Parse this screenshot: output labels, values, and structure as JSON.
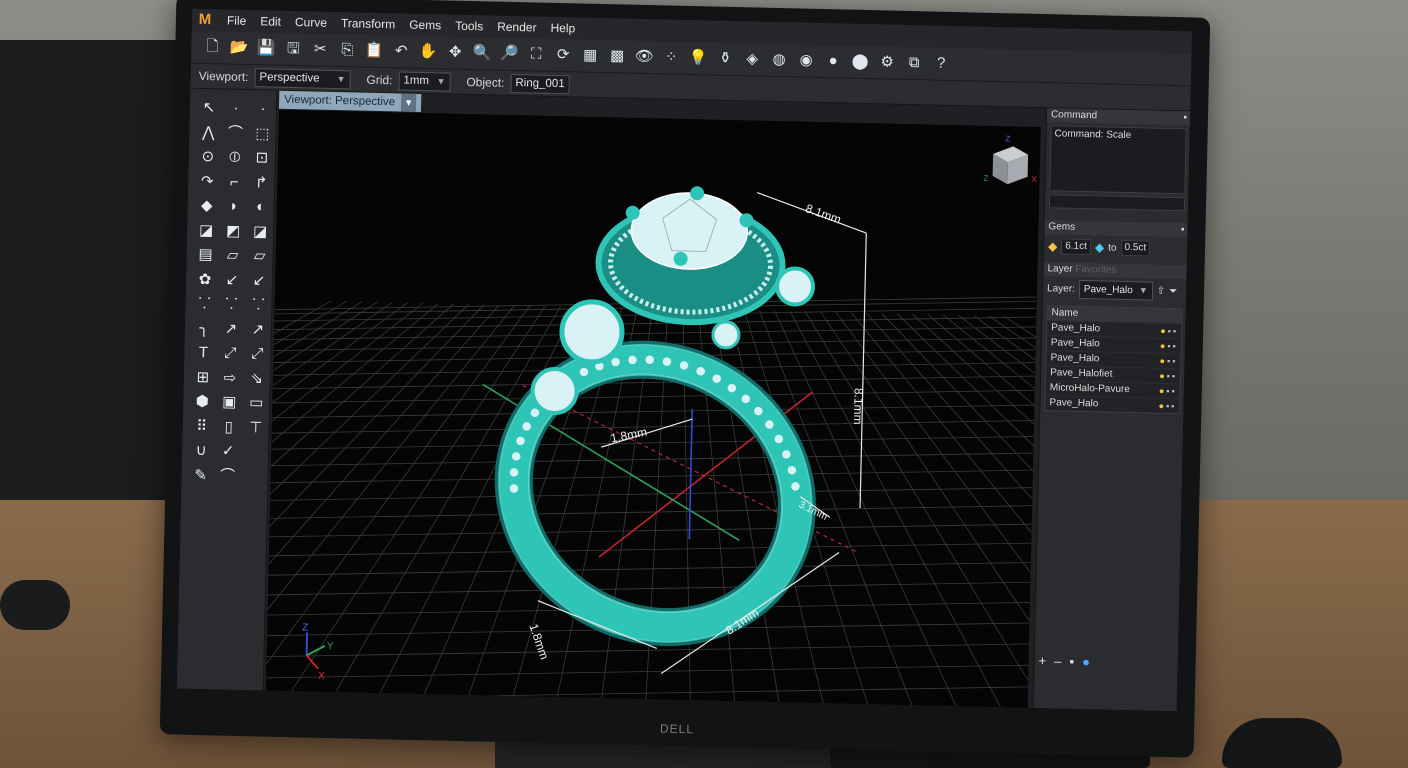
{
  "app": {
    "logo": "M",
    "menu": [
      "File",
      "Edit",
      "Curve",
      "Transform",
      "Gems",
      "Tools",
      "Render",
      "Help"
    ],
    "window_controls": [
      "–",
      "□",
      "✕"
    ]
  },
  "toolbar": {
    "icons": [
      {
        "name": "new-file-icon",
        "glyph": "🗋"
      },
      {
        "name": "open-folder-icon",
        "glyph": "📂"
      },
      {
        "name": "save-icon",
        "glyph": "💾"
      },
      {
        "name": "save-all-icon",
        "glyph": "🖫"
      },
      {
        "name": "cut-icon",
        "glyph": "✂"
      },
      {
        "name": "copy-icon",
        "glyph": "⎘"
      },
      {
        "name": "paste-icon",
        "glyph": "📋"
      },
      {
        "name": "undo-icon",
        "glyph": "↶"
      },
      {
        "name": "pan-hand-icon",
        "glyph": "✋"
      },
      {
        "name": "move-icon",
        "glyph": "✥"
      },
      {
        "name": "zoom-in-icon",
        "glyph": "🔍"
      },
      {
        "name": "zoom-window-icon",
        "glyph": "🔎"
      },
      {
        "name": "zoom-extents-icon",
        "glyph": "⛶"
      },
      {
        "name": "rotate-view-icon",
        "glyph": "⟳"
      },
      {
        "name": "grid-icon",
        "glyph": "▦"
      },
      {
        "name": "viewports-icon",
        "glyph": "▩"
      },
      {
        "name": "eye-icon",
        "glyph": "👁"
      },
      {
        "name": "dots-icon",
        "glyph": "⁘"
      },
      {
        "name": "light-bulb-icon",
        "glyph": "💡"
      },
      {
        "name": "bottle-icon",
        "glyph": "⚱"
      },
      {
        "name": "layers-icon",
        "glyph": "◈"
      },
      {
        "name": "material-icon",
        "glyph": "◍"
      },
      {
        "name": "sphere-icon",
        "glyph": "◉"
      },
      {
        "name": "shade-icon",
        "glyph": "●"
      },
      {
        "name": "render-ball-icon",
        "glyph": "⬤"
      },
      {
        "name": "scripts-icon",
        "glyph": "⚙"
      },
      {
        "name": "plugin-icon",
        "glyph": "⧉"
      },
      {
        "name": "help-icon",
        "glyph": "?"
      }
    ]
  },
  "options": {
    "viewport_label": "Viewport:",
    "viewport_value": "Perspective",
    "grid_label": "Grid:",
    "grid_value": "1mm",
    "object_label": "Object:",
    "object_value": "Ring_001"
  },
  "palette": {
    "icons": [
      "↖",
      "·",
      "·",
      "⋀",
      "⌒",
      "⬚",
      "⊙",
      "⦶",
      "⊡",
      "↷",
      "⌐",
      "↱",
      "◆",
      "◗",
      "◐",
      "◪",
      "◩",
      "◪",
      "▤",
      "▱",
      "▱",
      "✿",
      "↙",
      "↙",
      "⸪",
      "⸪",
      "⸪",
      "╮",
      "↗",
      "↗",
      "T",
      "⤢",
      "⤢",
      "⊞",
      "⇨",
      "⇘",
      "⬢",
      "▣",
      "▭",
      "⠿",
      "▯",
      "⊤",
      "∪",
      "✓",
      " ",
      "✎",
      "⌒",
      " "
    ]
  },
  "viewport": {
    "tab_label": "Viewport: Perspective",
    "dimensions": {
      "top": "8.1mm",
      "right": "8.1mm",
      "band": "1.8mm",
      "side": "3.1mm",
      "bottom_left": "1.8mm",
      "bottom": "8.1mm"
    },
    "axis_labels": {
      "x": "X",
      "y": "Y",
      "z": "Z"
    },
    "viewcube_labels": {
      "z": "Z",
      "x": "X",
      "y": "Z"
    }
  },
  "right_panel": {
    "command_title": "Command",
    "command_text": "Command: Scale",
    "gems_title": "Gems",
    "gem_from": "6.1ct",
    "gem_to_label": "to",
    "gem_to": "0.5ct",
    "layer_title": "Layer",
    "layer_ghost": "Favorites",
    "layer_label": "Layer:",
    "layer_value": "Pave_Halo",
    "table_header": "Name",
    "layers": [
      "Pave_Halo",
      "Pave_Halo",
      "Pave_Halo",
      "Pave_Halofiet",
      "MicroHalo-Pavure",
      "Pave_Halo"
    ],
    "footer_icons": [
      "+",
      "–",
      "▪",
      "●"
    ]
  },
  "monitor_brand": "DELL",
  "colors": {
    "ring": "#2ec4b6",
    "ring_dark": "#0f6e69",
    "grid": "#3b3b3b",
    "x_axis": "#c0262c",
    "y_axis": "#2fa35a",
    "z_axis": "#2c4fd1",
    "dim_line": "#e8e8e8"
  }
}
